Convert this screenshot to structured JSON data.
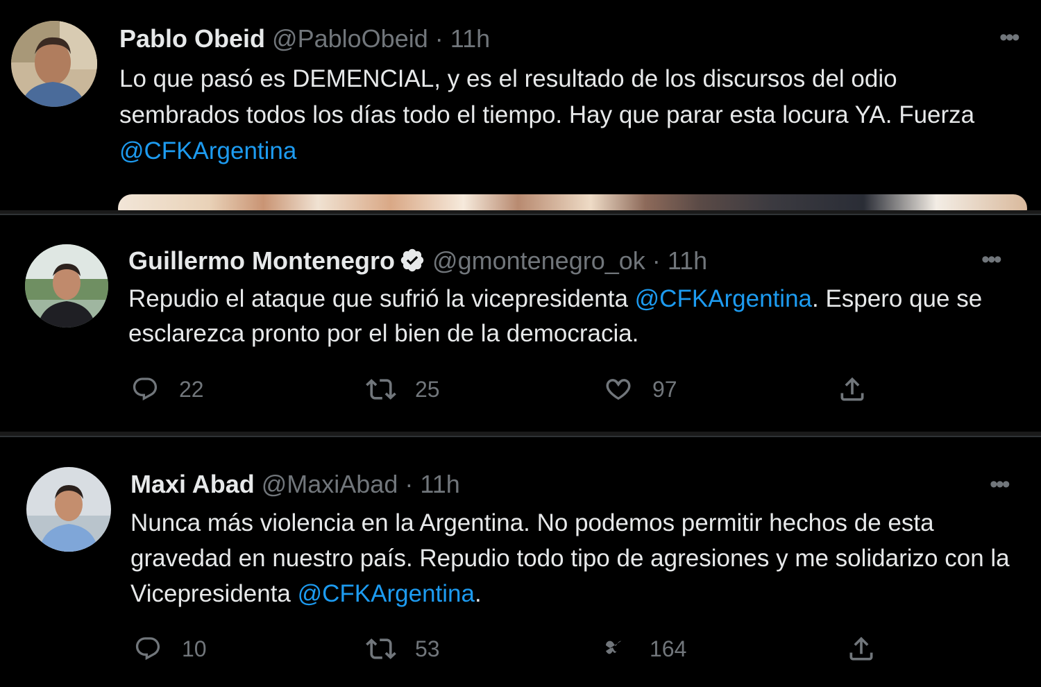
{
  "tweets": [
    {
      "name": "Pablo Obeid",
      "handle": "@PabloObeid",
      "time": "11h",
      "text_before": "Lo que pasó es DEMENCIAL, y es el resultado de los discursos del odio sembrados todos los días todo el tiempo. Hay que parar esta locura YA. Fuerza ",
      "mention": "@CFKArgentina",
      "text_after": "",
      "more_icon": "more-dots-icon"
    },
    {
      "name": "Guillermo Montenegro",
      "handle": "@gmontenegro_ok",
      "time": "11h",
      "verified_icon": "verified-badge-icon",
      "text_before": "Repudio el ataque que sufrió la vicepresidenta ",
      "mention": "@CFKArgentina",
      "text_after": ". Espero que se esclarezca pronto por el bien de la democracia.",
      "replies": "22",
      "retweets": "25",
      "likes": "97"
    },
    {
      "name": "Maxi Abad",
      "handle": "@MaxiAbad",
      "time": "11h",
      "text_before": "Nunca más violencia en la Argentina. No podemos permitir hechos de esta gravedad en nuestro país. Repudio todo tipo de agresiones y me solidarizo con la Vicepresidenta ",
      "mention": "@CFKArgentina",
      "text_after": ".",
      "replies": "10",
      "retweets": "53",
      "likes": "164"
    }
  ],
  "sep": "·",
  "colors": {
    "background": "#000000",
    "text": "#e7e9ea",
    "muted": "#71767b",
    "link": "#1d9bf0"
  }
}
